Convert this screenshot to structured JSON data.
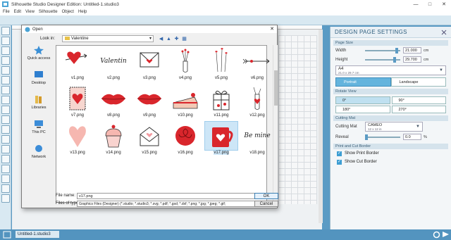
{
  "app": {
    "title": "Silhouette Studio Designer Edition: Untitled-1.studio3",
    "window_controls": [
      "—",
      "□",
      "✕"
    ],
    "menu": [
      "File",
      "Edit",
      "View",
      "Silhouette",
      "Object",
      "Help"
    ]
  },
  "doc_tab": "Untitled-1.studio3",
  "dialog": {
    "title": "Open",
    "close_glyph": "✕",
    "look_in_label": "Look in:",
    "look_in_value": "Valentine",
    "places": [
      "Quick access",
      "Desktop",
      "Libraries",
      "This PC",
      "Network"
    ],
    "files": [
      {
        "name": "v1.png",
        "icon": "heart-arrow"
      },
      {
        "name": "v2.png",
        "icon": "valentine-script"
      },
      {
        "name": "v3.png",
        "icon": "envelope-heart"
      },
      {
        "name": "v4.png",
        "icon": "vase-flowers"
      },
      {
        "name": "v5.png",
        "icon": "heart-stems"
      },
      {
        "name": "v6.png",
        "icon": "arrow"
      },
      {
        "name": "v7.png",
        "icon": "heart-stamp"
      },
      {
        "name": "v8.png",
        "icon": "lips"
      },
      {
        "name": "v9.png",
        "icon": "lips"
      },
      {
        "name": "v10.png",
        "icon": "cake-slice"
      },
      {
        "name": "v11.png",
        "icon": "gift-box"
      },
      {
        "name": "v12.png",
        "icon": "bottle-heart"
      },
      {
        "name": "v13.png",
        "icon": "heart-pink"
      },
      {
        "name": "v14.png",
        "icon": "cupcake"
      },
      {
        "name": "v15.png",
        "icon": "envelope-open"
      },
      {
        "name": "v16.png",
        "icon": "rose"
      },
      {
        "name": "v17.png",
        "icon": "mug-heart"
      },
      {
        "name": "v18.png",
        "icon": "be-mine-script"
      }
    ],
    "thumb_text": {
      "v2": "Valentin",
      "v18": "Be mine"
    },
    "file_name_label": "File name:",
    "file_name_value": "v17.png",
    "files_of_type_label": "Files of type:",
    "files_of_type_value": "Graphics Files (Designer) (*.studio; *.studio3; *.svg; *.pdf; *.gsd; *.dxf; *.png; *.jpg; *.jpeg; *.gif;",
    "ok_label": "OK",
    "cancel_label": "Cancel"
  },
  "panel": {
    "title": "DESIGN PAGE SETTINGS",
    "page_size_header": "Page Size",
    "width_label": "Width",
    "width_value": "21.000",
    "height_label": "Height",
    "height_value": "29.700",
    "unit": "cm",
    "paper_name": "A4",
    "paper_dims": "21.0 x 29.7 cm",
    "portrait_label": "Portrait",
    "landscape_label": "Landscape",
    "rotate_header": "Rotate View",
    "rotations": [
      "0°",
      "90°",
      "180°",
      "270°"
    ],
    "cutting_mat_header": "Cutting Mat",
    "cutting_mat_label": "Cutting Mat",
    "cutting_mat_value": "CAMEO",
    "cutting_mat_sub": "12 x 12 in",
    "reveal_label": "Reveal",
    "reveal_value": "0.0",
    "reveal_unit": "%",
    "border_header": "Print and Cut Border",
    "show_print_border": "Show Print Border",
    "show_cut_border": "Show Cut Border",
    "check_glyph": "✓"
  },
  "colors": {
    "accent": "#5b9bc4",
    "heart_red": "#d9262c",
    "selection": "#cde6f7"
  }
}
